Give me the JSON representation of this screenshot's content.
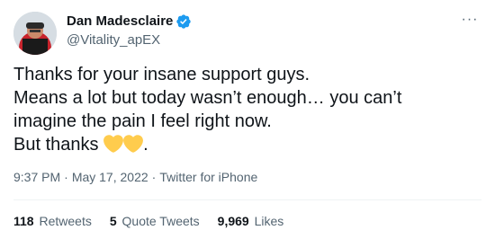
{
  "author": {
    "display_name": "Dan Madesclaire",
    "handle": "@Vitality_apEX",
    "verified_icon": "verified-badge-icon",
    "avatar": "profile-avatar"
  },
  "more_menu": {
    "icon": "more-options-icon",
    "glyph": "···"
  },
  "tweet": {
    "lines": [
      "Thanks for your insane support guys.",
      "Means a lot but today wasn’t enough… you can’t",
      "imagine the pain I feel right now."
    ],
    "closing_text": "But thanks ",
    "closing_emojis": [
      "yellow-heart-icon",
      "yellow-heart-icon"
    ],
    "closing_punct": "."
  },
  "meta": {
    "time": "9:37 PM",
    "separator": "·",
    "date": "May 17, 2022",
    "source": "Twitter for iPhone"
  },
  "stats": {
    "retweets_count": "118",
    "retweets_label": "Retweets",
    "quotes_count": "5",
    "quotes_label": "Quote Tweets",
    "likes_count": "9,969",
    "likes_label": "Likes"
  },
  "colors": {
    "text_primary": "#0f1419",
    "text_secondary": "#536471",
    "verified_blue": "#1d9bf0",
    "heart_yellow": "#ffcc4d",
    "divider": "#eff3f4"
  }
}
